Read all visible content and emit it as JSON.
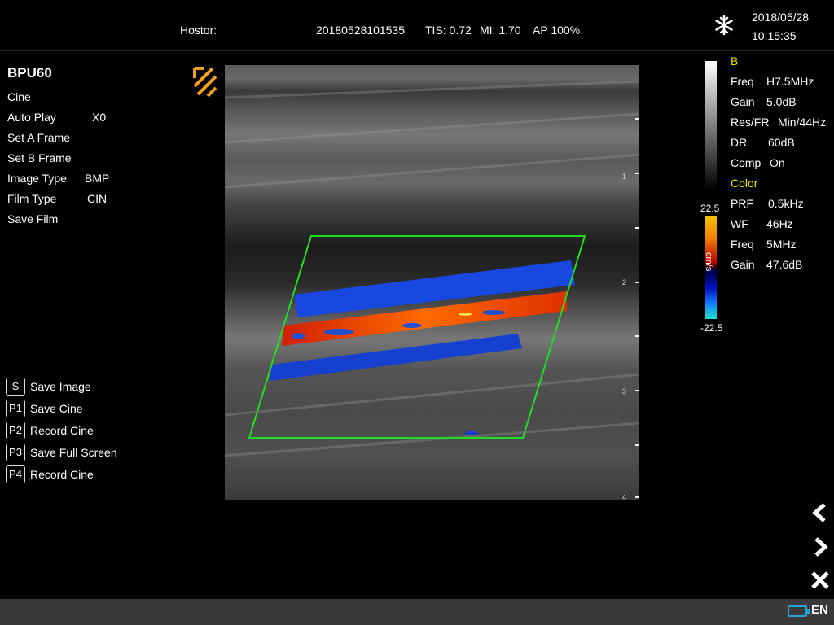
{
  "header": {
    "hospital_label": "Hostor:",
    "study_id": "20180528101535",
    "tis": "TIS: 0.72",
    "mi": "MI: 1.70",
    "ap": "AP 100%",
    "date": "2018/05/28",
    "time": "10:15:35",
    "freeze_icon": "snowflake-icon"
  },
  "left_panel": {
    "brand": "BPU60",
    "menu": [
      {
        "label": "Cine",
        "value": ""
      },
      {
        "label": "Auto Play",
        "value": "X0"
      },
      {
        "label": "Set A Frame",
        "value": ""
      },
      {
        "label": "Set B Frame",
        "value": ""
      },
      {
        "label": "Image Type",
        "value": "BMP"
      },
      {
        "label": "Film Type",
        "value": "CIN"
      },
      {
        "label": "Save Film",
        "value": ""
      }
    ],
    "shortcuts": [
      {
        "key": "S",
        "label": "Save Image"
      },
      {
        "key": "P1",
        "label": "Save Cine"
      },
      {
        "key": "P2",
        "label": "Record Cine"
      },
      {
        "key": "P3",
        "label": "Save Full Screen"
      },
      {
        "key": "P4",
        "label": "Record Cine"
      }
    ]
  },
  "image": {
    "depth_marks": [
      "1",
      "2",
      "3",
      "4"
    ],
    "roi_color": "#22dd22"
  },
  "color_scale": {
    "max": "22.5",
    "min": "-22.5",
    "unit": "cm/s"
  },
  "params": {
    "b_title": "B",
    "b": [
      {
        "label": "Freq",
        "value": "H7.5MHz"
      },
      {
        "label": "Gain",
        "value": "5.0dB"
      },
      {
        "label": "Res/FR",
        "value": "Min/44Hz"
      },
      {
        "label": "DR",
        "value": "60dB"
      },
      {
        "label": "Comp",
        "value": "On"
      }
    ],
    "color_title": "Color",
    "color": [
      {
        "label": "PRF",
        "value": "0.5kHz"
      },
      {
        "label": "WF",
        "value": "46Hz"
      },
      {
        "label": "Freq",
        "value": "5MHz"
      },
      {
        "label": "Gain",
        "value": "47.6dB"
      }
    ]
  },
  "status": {
    "language": "EN",
    "battery_icon": "battery-icon"
  }
}
